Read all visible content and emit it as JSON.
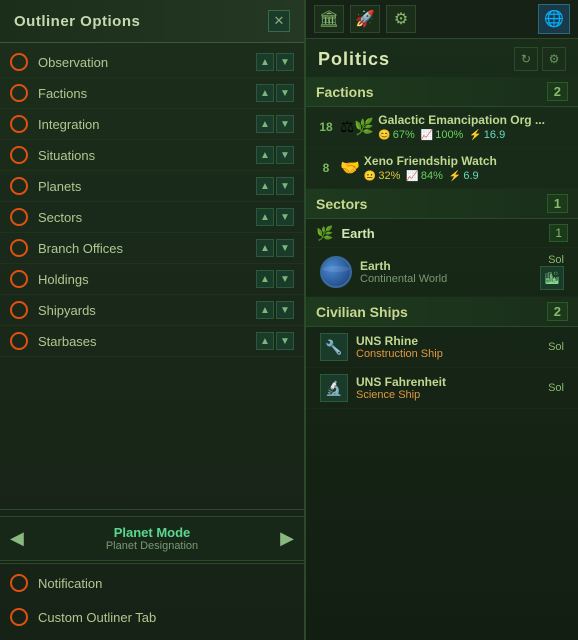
{
  "leftPanel": {
    "title": "Outliner Options",
    "closeBtn": "✕",
    "items": [
      {
        "label": "Observation",
        "id": "observation"
      },
      {
        "label": "Factions",
        "id": "factions"
      },
      {
        "label": "Integration",
        "id": "integration"
      },
      {
        "label": "Situations",
        "id": "situations"
      },
      {
        "label": "Planets",
        "id": "planets"
      },
      {
        "label": "Sectors",
        "id": "sectors"
      },
      {
        "label": "Branch Offices",
        "id": "branch-offices"
      },
      {
        "label": "Holdings",
        "id": "holdings"
      },
      {
        "label": "Shipyards",
        "id": "shipyards"
      },
      {
        "label": "Starbases",
        "id": "starbases"
      }
    ],
    "planetMode": {
      "label": "Planet Mode",
      "sublabel": "Planet Designation",
      "prevBtn": "◀",
      "nextBtn": "▶"
    },
    "notification": "Notification",
    "customTab": "Custom Outliner Tab"
  },
  "rightPanel": {
    "title": "Politics",
    "toolbar": {
      "icons": [
        "🏛",
        "🚀",
        "⚙",
        "🌐"
      ]
    },
    "factions": {
      "label": "Factions",
      "count": "2",
      "items": [
        {
          "number": "18",
          "name": "Galactic Emancipation Org ...",
          "stats": [
            {
              "icon": "😊",
              "value": "67%",
              "color": "green"
            },
            {
              "icon": "📈",
              "value": "100%",
              "color": "green"
            },
            {
              "icon": "⚡",
              "value": "16.9",
              "color": "teal"
            }
          ]
        },
        {
          "number": "8",
          "name": "Xeno Friendship Watch",
          "stats": [
            {
              "icon": "😐",
              "value": "32%",
              "color": "yellow"
            },
            {
              "icon": "📈",
              "value": "84%",
              "color": "green"
            },
            {
              "icon": "⚡",
              "value": "6.9",
              "color": "teal"
            }
          ]
        }
      ]
    },
    "sectors": {
      "label": "Sectors",
      "count": "1",
      "subsections": [
        {
          "name": "Earth",
          "count": "1",
          "planets": [
            {
              "name": "Earth",
              "type": "Continental World",
              "location": "Sol"
            }
          ]
        }
      ]
    },
    "civilianShips": {
      "label": "Civilian Ships",
      "count": "2",
      "ships": [
        {
          "name": "UNS Rhine",
          "type": "Construction Ship",
          "location": "Sol"
        },
        {
          "name": "UNS Fahrenheit",
          "type": "Science Ship",
          "location": "Sol"
        }
      ]
    }
  }
}
